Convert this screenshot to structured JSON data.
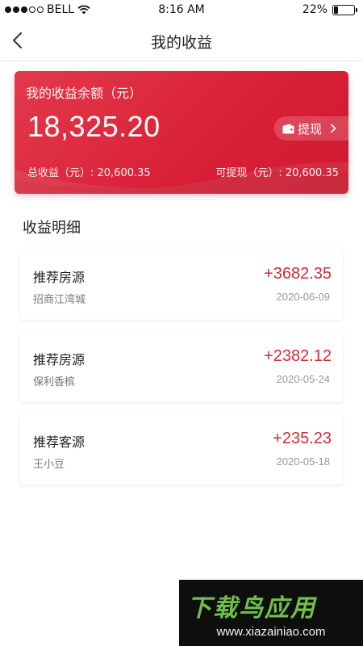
{
  "status_bar": {
    "carrier": "BELL",
    "time": "8:16 AM",
    "battery_percent": "22%",
    "battery_level": 0.22,
    "signal_bars_filled": 3,
    "signal_bars_total": 5
  },
  "nav": {
    "title": "我的收益",
    "back_icon": "chevron-left-icon"
  },
  "balance_card": {
    "label": "我的收益余额（元）",
    "balance": "18,325.20",
    "withdraw_label": "提现",
    "withdraw_icon": "wallet-icon",
    "total_label": "总收益（元）: 20,600.35",
    "available_label": "可提现（元）: 20,600.35",
    "accent_color": "#d91f37"
  },
  "income_section": {
    "title": "收益明细",
    "items": [
      {
        "title": "推荐房源",
        "subtitle": "招商江湾城",
        "amount": "+3682.35",
        "date": "2020-06-09"
      },
      {
        "title": "推荐房源",
        "subtitle": "保利香槟",
        "amount": "+2382.12",
        "date": "2020-05-24"
      },
      {
        "title": "推荐客源",
        "subtitle": "王小豆",
        "amount": "+235.23",
        "date": "2020-05-18"
      }
    ]
  },
  "watermark": {
    "logo_text": "下载鸟应用",
    "url": "www.xiazainiao.com"
  }
}
